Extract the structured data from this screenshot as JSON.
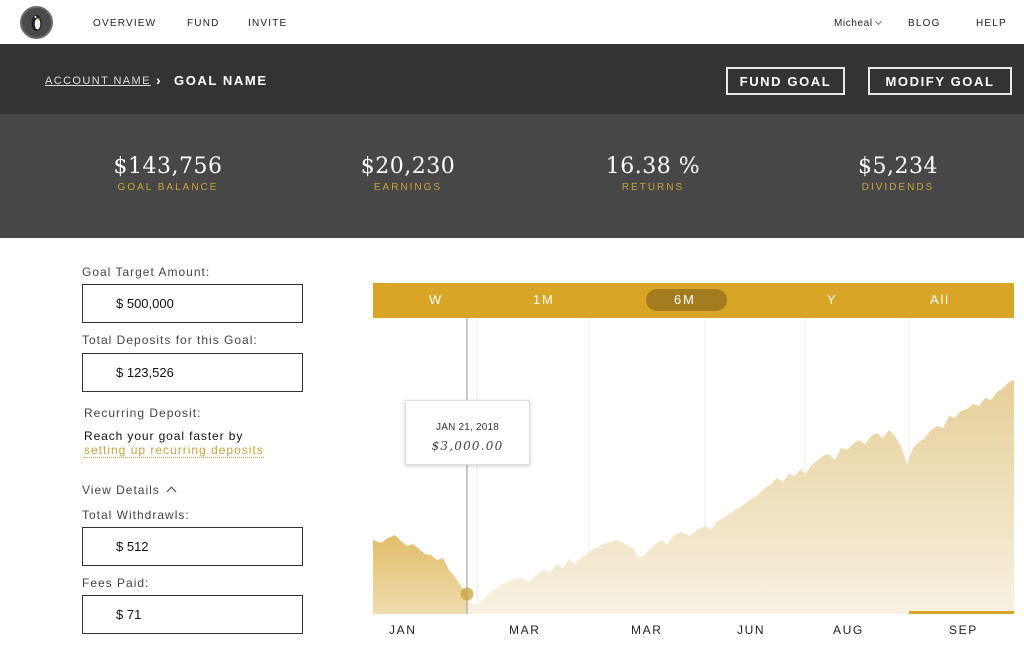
{
  "nav": {
    "logo": "penguin-logo",
    "links": [
      "OVERVIEW",
      "FUND",
      "INVITE"
    ],
    "user": "Micheal",
    "right_links": [
      "BLOG",
      "HELP"
    ]
  },
  "header": {
    "account_name": "ACCOUNT NAME",
    "goal_name": "GOAL NAME",
    "fund_goal_label": "FUND GOAL",
    "modify_goal_label": "MODIFY GOAL"
  },
  "stats": [
    {
      "value": "$143,756",
      "label": "GOAL BALANCE"
    },
    {
      "value": "$20,230",
      "label": "EARNINGS"
    },
    {
      "value": "16.38 %",
      "label": "RETURNS"
    },
    {
      "value": "$5,234",
      "label": "DIVIDENDS"
    }
  ],
  "form": {
    "goal_target_label": "Goal Target Amount:",
    "goal_target_value": "$ 500,000",
    "total_deposits_label": "Total Deposits for this Goal:",
    "total_deposits_value": "$ 123,526",
    "recurring_label": "Recurring Deposit:",
    "recurring_text": "Reach your goal faster by",
    "recurring_link": "setting up recurring deposits",
    "view_details": "View Details",
    "withdrawals_label": "Total Withdrawls:",
    "withdrawals_value": "$ 512",
    "fees_label": "Fees Paid:",
    "fees_value": "$ 71"
  },
  "chart": {
    "ranges": [
      "W",
      "1M",
      "6M",
      "Y",
      "All"
    ],
    "active_range": "6M",
    "x_labels": [
      "JAN",
      "MAR",
      "MAR",
      "JUN",
      "AUG",
      "SEP"
    ],
    "tooltip_date": "JAN 21, 2018",
    "tooltip_value": "$3,000.00"
  },
  "colors": {
    "accent": "#d9a526",
    "active_pill": "#a37c21",
    "header_dark": "#333333",
    "stats_bg": "#474747"
  }
}
